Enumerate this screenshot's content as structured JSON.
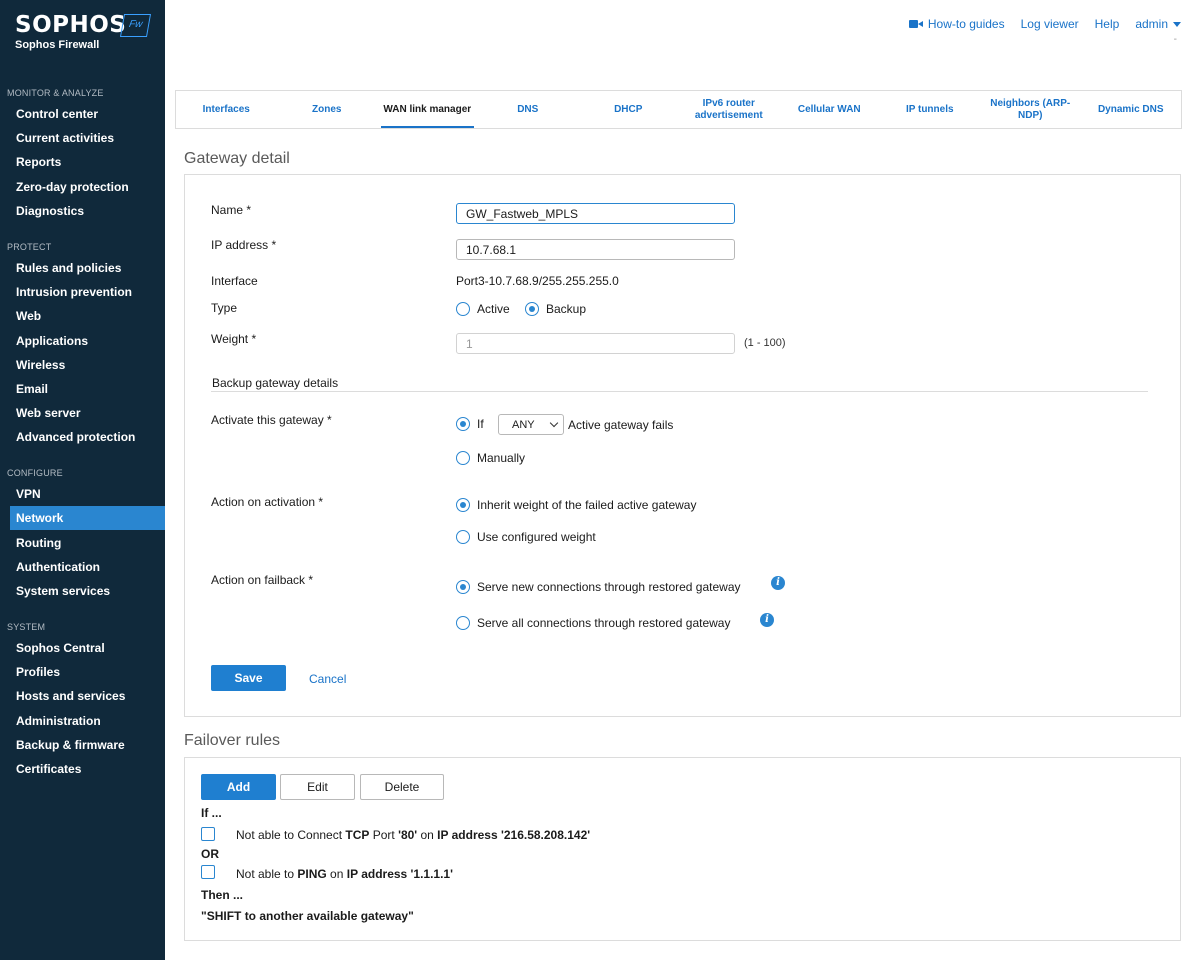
{
  "brand": {
    "name": "SOPHOS",
    "product": "Sophos Firewall",
    "logo_text": "Fw"
  },
  "sidebar": {
    "monitor": {
      "header": "MONITOR & ANALYZE",
      "items": [
        "Control center",
        "Current activities",
        "Reports",
        "Zero-day protection",
        "Diagnostics"
      ]
    },
    "protect": {
      "header": "PROTECT",
      "items": [
        "Rules and policies",
        "Intrusion prevention",
        "Web",
        "Applications",
        "Wireless",
        "Email",
        "Web server",
        "Advanced protection"
      ]
    },
    "configure": {
      "header": "CONFIGURE",
      "items": [
        "VPN",
        "Network",
        "Routing",
        "Authentication",
        "System services"
      ]
    },
    "system": {
      "header": "SYSTEM",
      "items": [
        "Sophos Central",
        "Profiles",
        "Hosts and services",
        "Administration",
        "Backup & firmware",
        "Certificates"
      ]
    },
    "active_item": "Network"
  },
  "topbar": {
    "howto": "How-to guides",
    "logviewer": "Log viewer",
    "help": "Help",
    "admin": "admin",
    "dash": "-"
  },
  "tabs": [
    {
      "label": "Interfaces"
    },
    {
      "label": "Zones"
    },
    {
      "label": "WAN link manager",
      "active": true
    },
    {
      "label": "DNS"
    },
    {
      "label": "DHCP"
    },
    {
      "label": "IPv6 router advertisement"
    },
    {
      "label": "Cellular WAN"
    },
    {
      "label": "IP tunnels"
    },
    {
      "label": "Neighbors (ARP-NDP)"
    },
    {
      "label": "Dynamic DNS"
    }
  ],
  "gateway": {
    "title": "Gateway detail",
    "name_label": "Name *",
    "name_value": "GW_Fastweb_MPLS",
    "ip_label": "IP address *",
    "ip_value": "10.7.68.1",
    "interface_label": "Interface",
    "interface_value": "Port3-10.7.68.9/255.255.255.0",
    "type_label": "Type",
    "type_active": "Active",
    "type_backup": "Backup",
    "weight_label": "Weight *",
    "weight_value": "1",
    "weight_range": "(1 - 100)",
    "backup_heading": "Backup gateway details",
    "activate_label": "Activate this gateway *",
    "activate_if": "If",
    "activate_select": "ANY",
    "activate_suffix": "Active gateway fails",
    "activate_manual": "Manually",
    "action_activation_label": "Action on activation *",
    "inherit_weight": "Inherit weight of the failed active gateway",
    "use_configured": "Use configured weight",
    "action_failback_label": "Action on failback *",
    "serve_new": "Serve new connections through restored gateway",
    "serve_all": "Serve all connections through restored gateway",
    "save": "Save",
    "cancel": "Cancel"
  },
  "failover": {
    "title": "Failover rules",
    "add": "Add",
    "edit": "Edit",
    "delete": "Delete",
    "if_label": "If ...",
    "rule1": {
      "prefix": "Not able to Connect ",
      "proto": "TCP",
      "mid": " Port ",
      "port": "'80'",
      "on": " on ",
      "ip_label": "IP address",
      "ip": " '216.58.208.142'"
    },
    "or_label": "OR",
    "rule2": {
      "prefix": "Not able to ",
      "proto": "PING",
      "on": " on ",
      "ip_label": "IP address",
      "ip": " '1.1.1.1'"
    },
    "then_label": "Then ...",
    "action": "\"SHIFT to another available gateway\""
  }
}
